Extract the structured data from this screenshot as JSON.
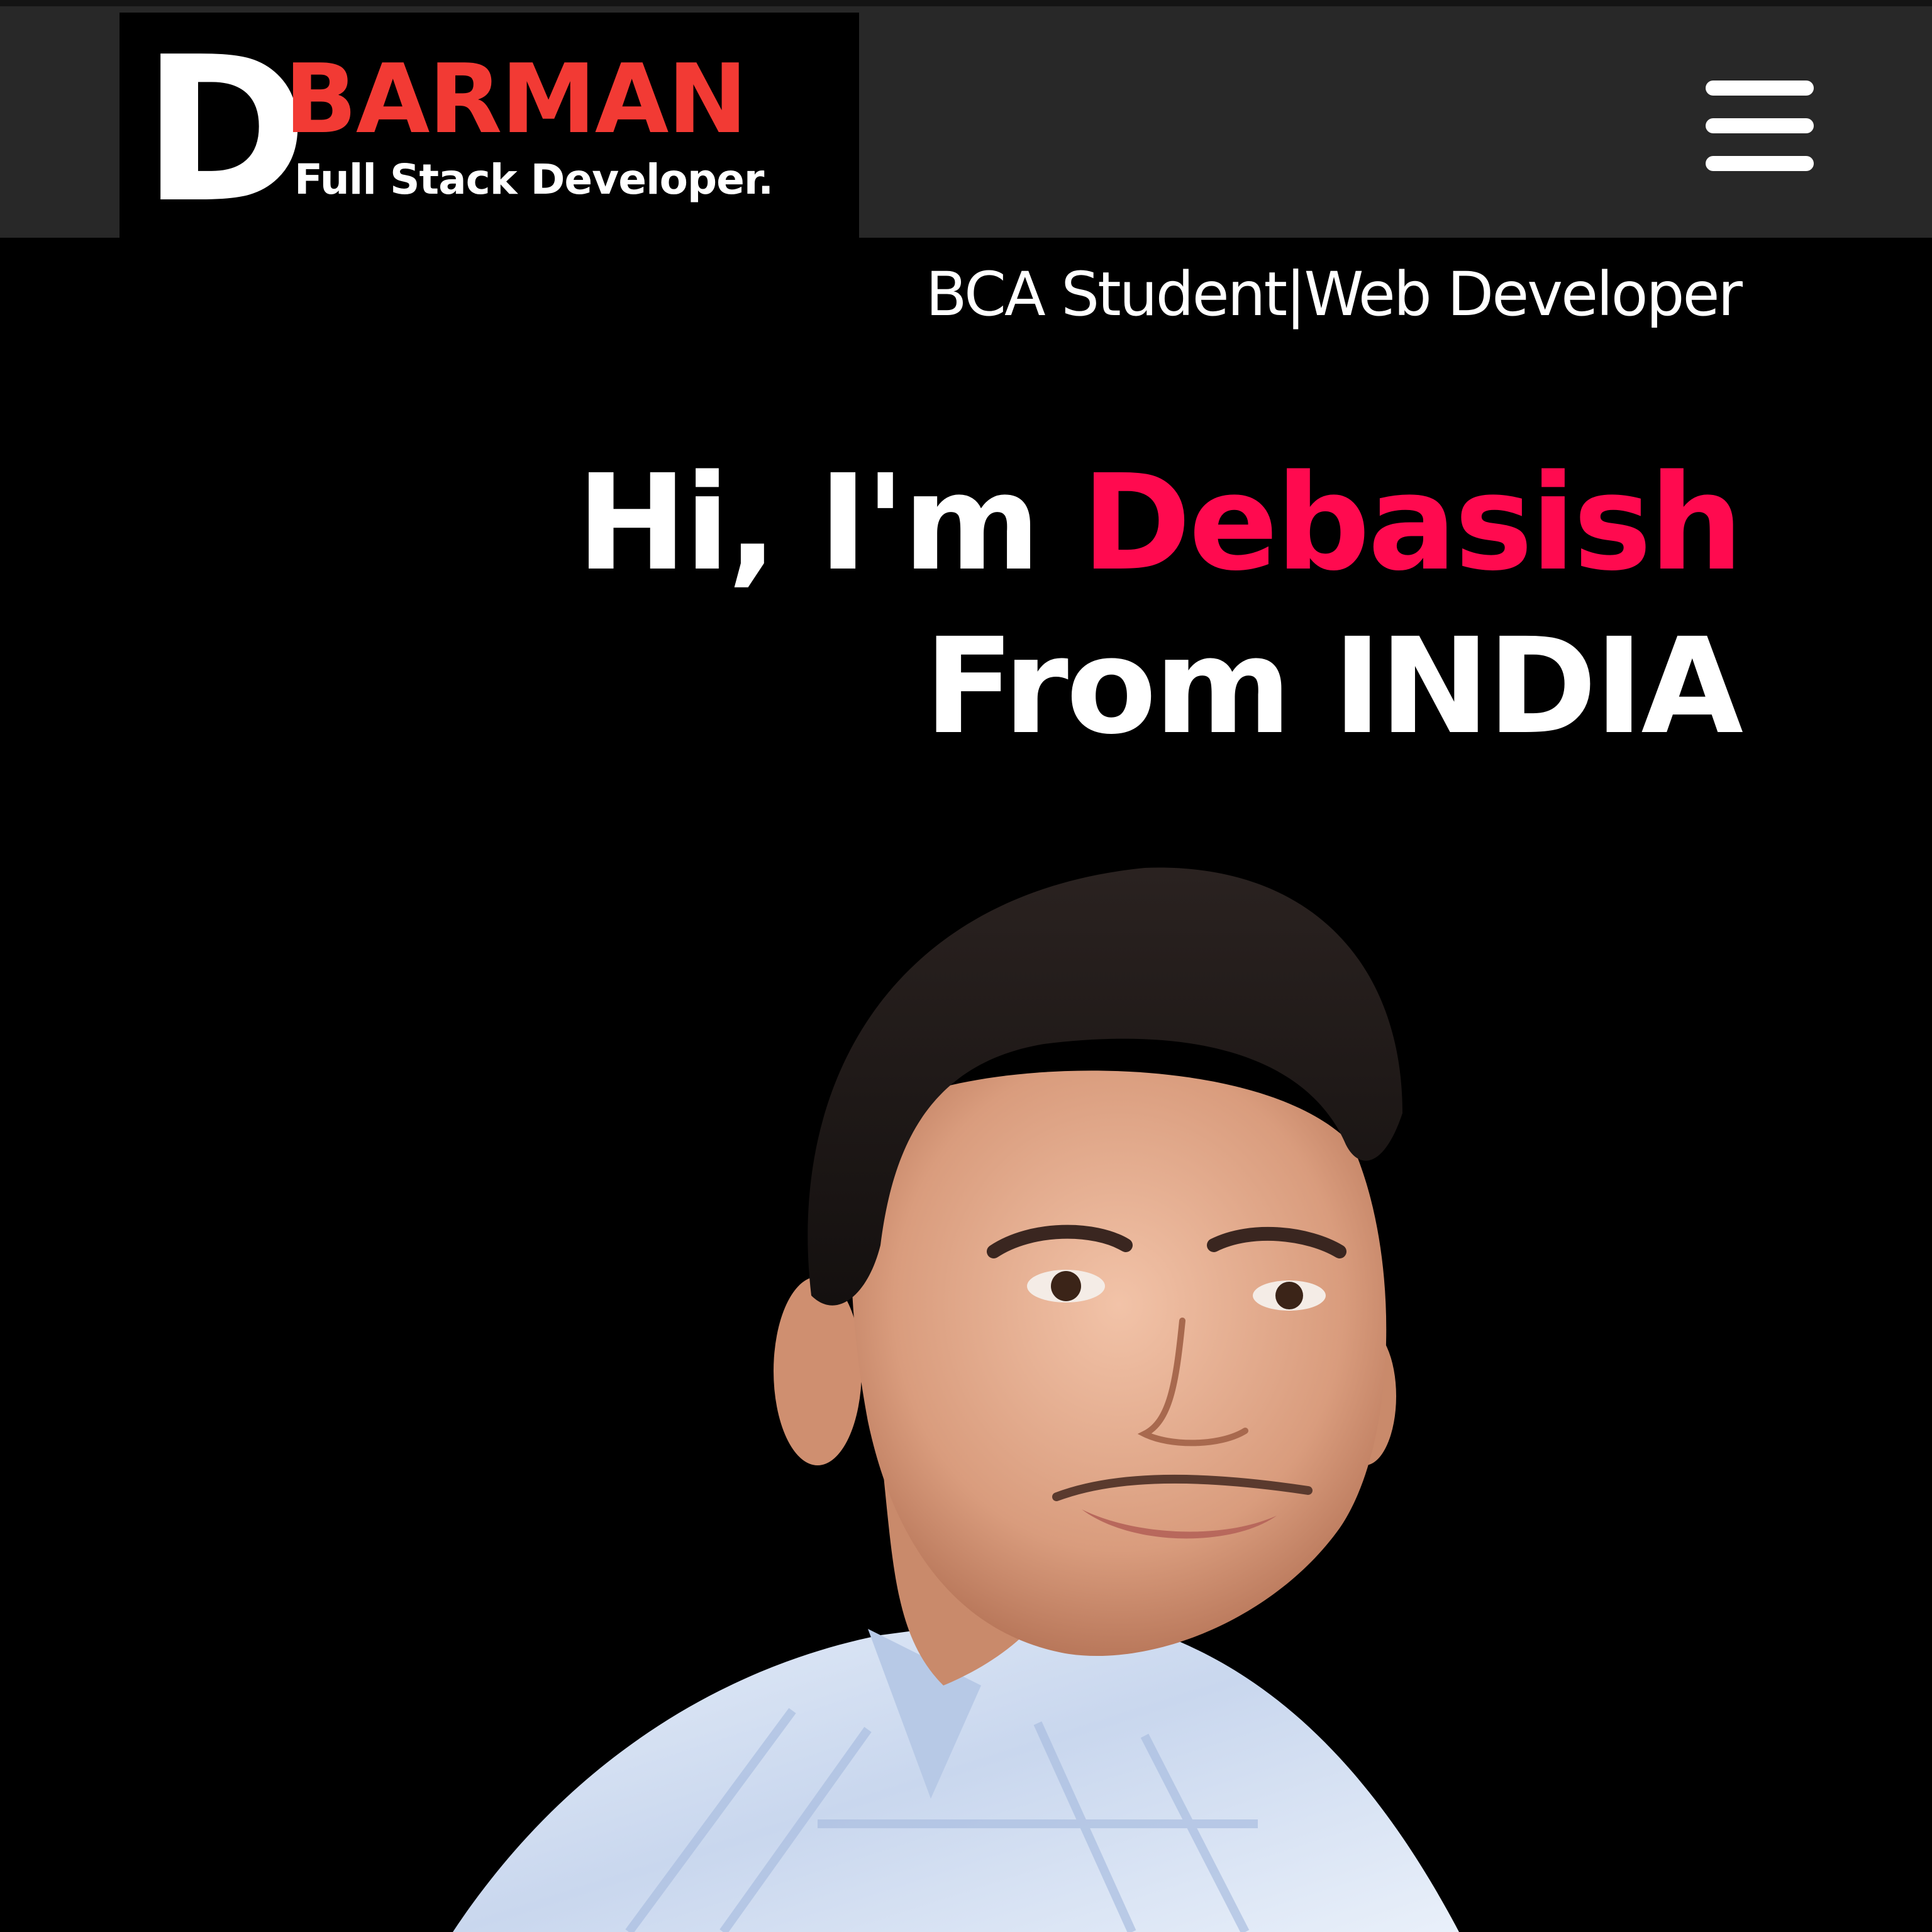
{
  "header": {
    "logo": {
      "letter": "D",
      "word": "BARMAN",
      "tagline": "Full Stack Developer."
    },
    "menu_icon": "hamburger-menu-icon"
  },
  "hero": {
    "subtitle": "BCA Student|Web Developer",
    "greeting": "Hi, I'm",
    "name": "Debasish",
    "location_line": "From INDIA"
  },
  "colors": {
    "background": "#000000",
    "header_bg": "#282828",
    "logo_accent": "#f23a34",
    "name_accent": "#ff0a4f",
    "text": "#ffffff"
  },
  "portrait": {
    "description_icon": "profile-photo"
  }
}
